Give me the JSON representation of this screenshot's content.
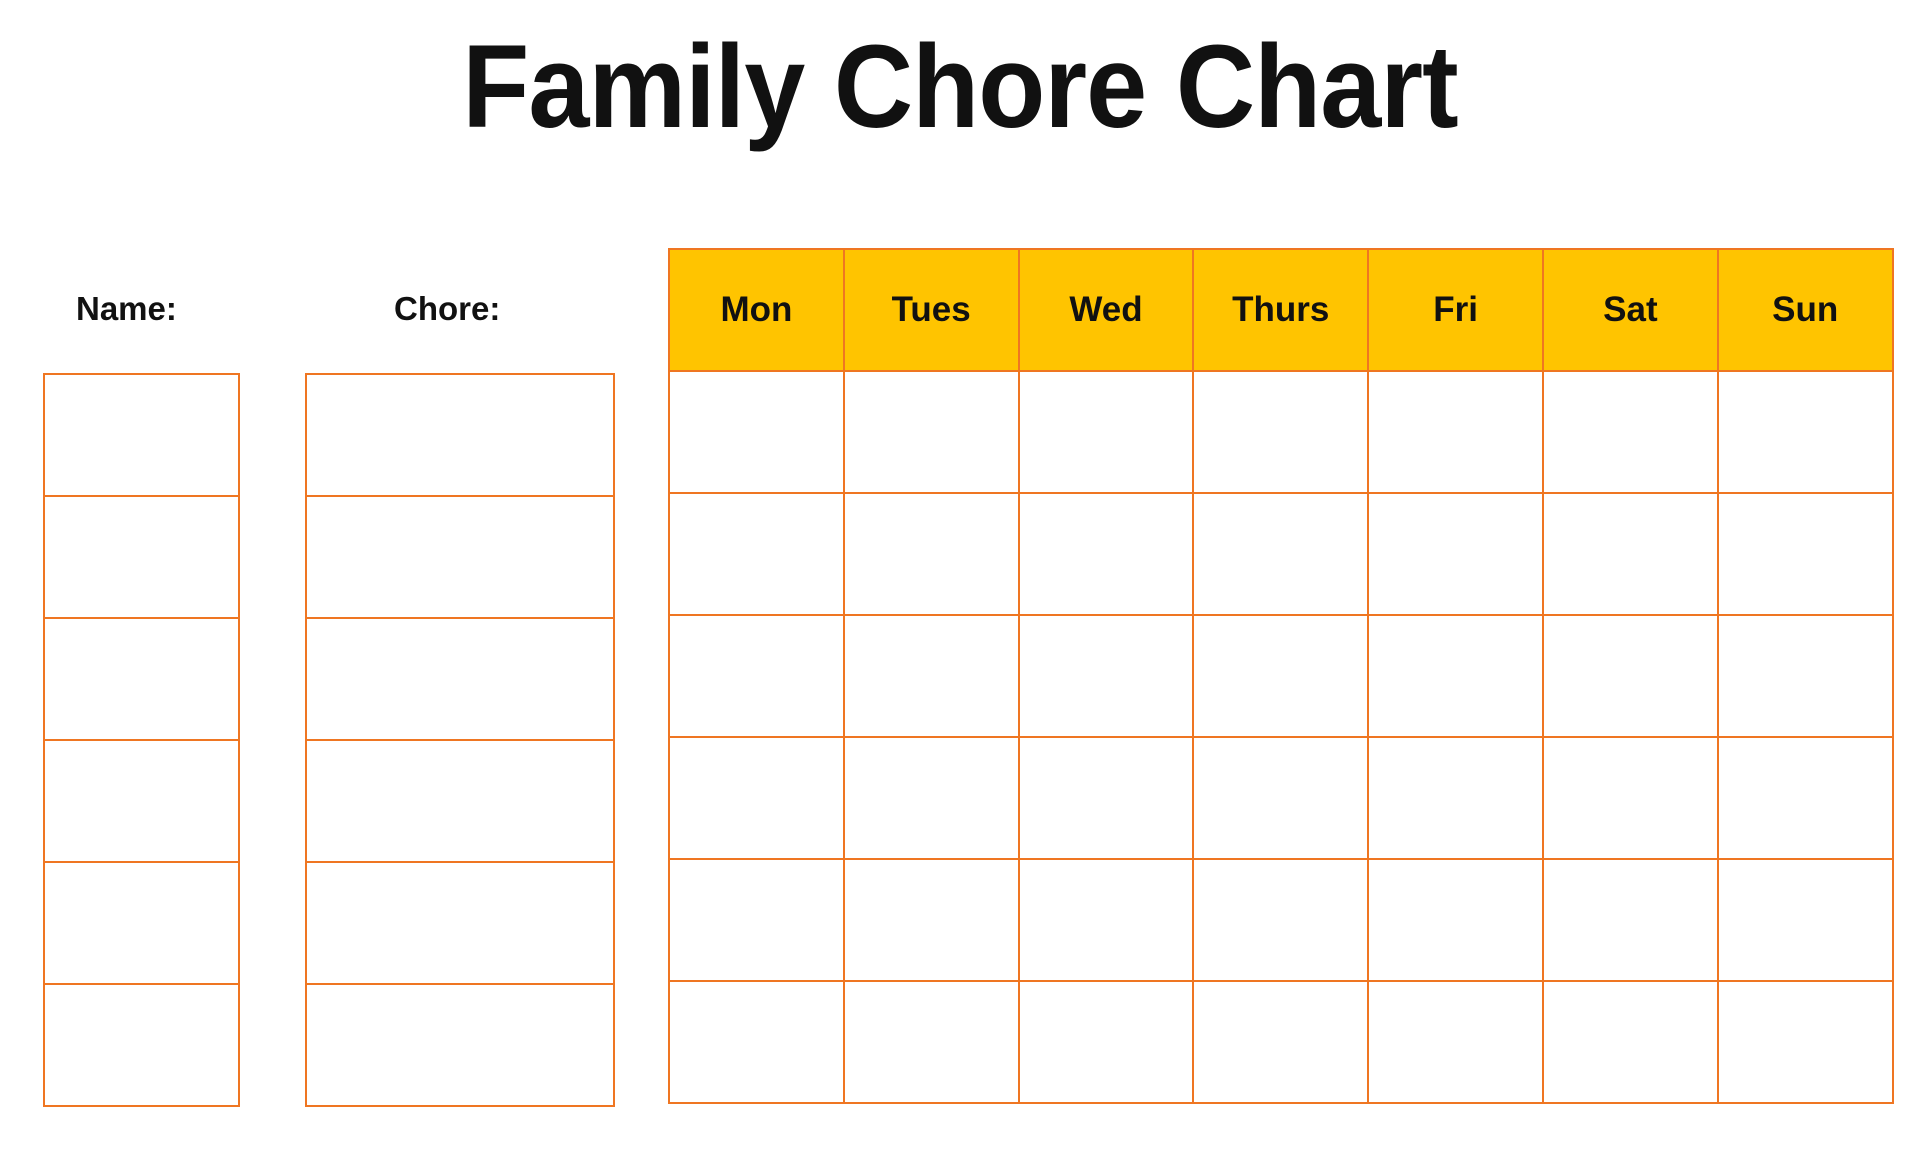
{
  "page": {
    "title": "Family Chore Chart",
    "background_color": "#ffffff",
    "accent_border_color": "#ef7622",
    "header_fill_color": "#ffc400",
    "text_color": "#111111"
  },
  "columns": {
    "name": {
      "heading": "Name:",
      "row_count": 6
    },
    "chore": {
      "heading": "Chore:",
      "row_count": 6
    }
  },
  "week_grid": {
    "day_headers": [
      "Mon",
      "Tues",
      "Wed",
      "Thurs",
      "Fri",
      "Sat",
      "Sun"
    ],
    "row_count": 6,
    "cells": [
      [
        "",
        "",
        "",
        "",
        "",
        "",
        ""
      ],
      [
        "",
        "",
        "",
        "",
        "",
        "",
        ""
      ],
      [
        "",
        "",
        "",
        "",
        "",
        "",
        ""
      ],
      [
        "",
        "",
        "",
        "",
        "",
        "",
        ""
      ],
      [
        "",
        "",
        "",
        "",
        "",
        "",
        ""
      ],
      [
        "",
        "",
        "",
        "",
        "",
        "",
        ""
      ]
    ]
  }
}
